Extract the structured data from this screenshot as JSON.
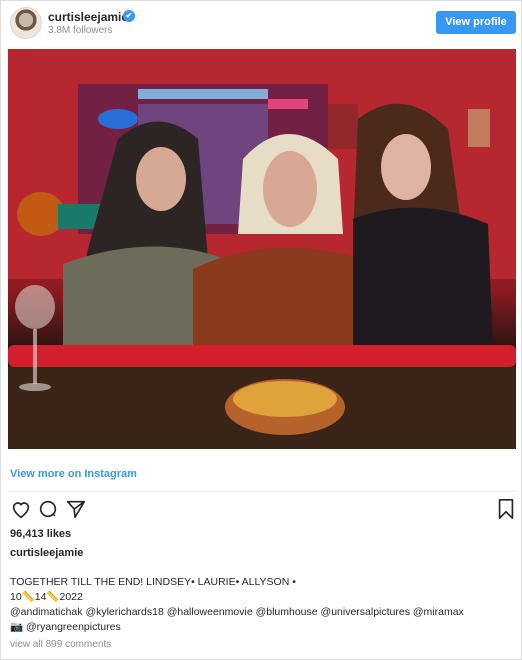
{
  "header": {
    "username": "curtisleejamie",
    "verified_mark": "✔",
    "followers": "3.8M followers",
    "view_profile_label": "View profile"
  },
  "post": {
    "image_icon": "photo-image",
    "view_more_label": "View more on Instagram",
    "likes": "96,413 likes",
    "caption_user": "curtisleejamie",
    "caption_line1": "TOGETHER TILL THE END! LINDSEY• LAURIE• ALLYSON •",
    "caption_line2": "10📏14📏2022",
    "caption_line3": "@andimatichak @kylerichards18 @halloweenmovie @blumhouse @universalpictures @miramax",
    "caption_line4": "📷 @ryangreenpictures",
    "comments_link": "view all 899 comments"
  },
  "colors": {
    "accent": "#3897f0",
    "muted": "#8e8e8e",
    "text": "#262626"
  }
}
